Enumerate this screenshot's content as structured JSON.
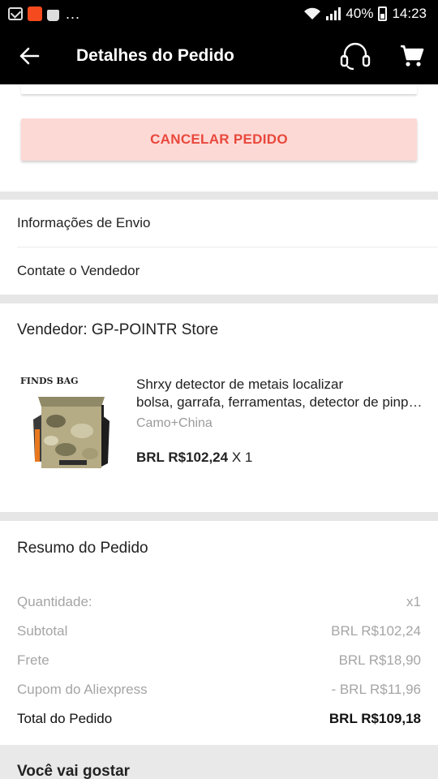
{
  "status_bar": {
    "battery": "40%",
    "time": "14:23"
  },
  "app_bar": {
    "title": "Detalhes do Pedido",
    "icons": [
      "back-arrow-icon",
      "headset-support-icon",
      "cart-icon"
    ]
  },
  "actions": {
    "cancel_label": "CANCELAR PEDIDO"
  },
  "links": [
    {
      "label": "Informações de Envio"
    },
    {
      "label": "Contate o Vendedor"
    }
  ],
  "seller": {
    "label": "Vendedor: GP-POINTR Store",
    "product": {
      "image_label": "FINDS BAG",
      "name_line1": "Shrxy detector de metais localizar",
      "name_line2": "bolsa, garrafa, ferramentas, detector de pinpointer",
      "variant": "Camo+China",
      "price": "BRL R$102,24",
      "quantity": "X 1"
    }
  },
  "summary": {
    "title": "Resumo do Pedido",
    "rows": [
      {
        "label": "Quantidade:",
        "value": "x1"
      },
      {
        "label": "Subtotal",
        "value": "BRL R$102,24"
      },
      {
        "label": "Frete",
        "value": "BRL R$18,90"
      },
      {
        "label": "Cupom do Aliexpress",
        "value": "- BRL R$11,96"
      },
      {
        "label": "Total do Pedido",
        "value": "BRL R$109,18"
      }
    ]
  },
  "recommendations": {
    "title": "Você vai gostar"
  },
  "colors": {
    "accent": "#e8483b",
    "cancel_bg": "#fdd9d6",
    "bar": "#000000"
  }
}
